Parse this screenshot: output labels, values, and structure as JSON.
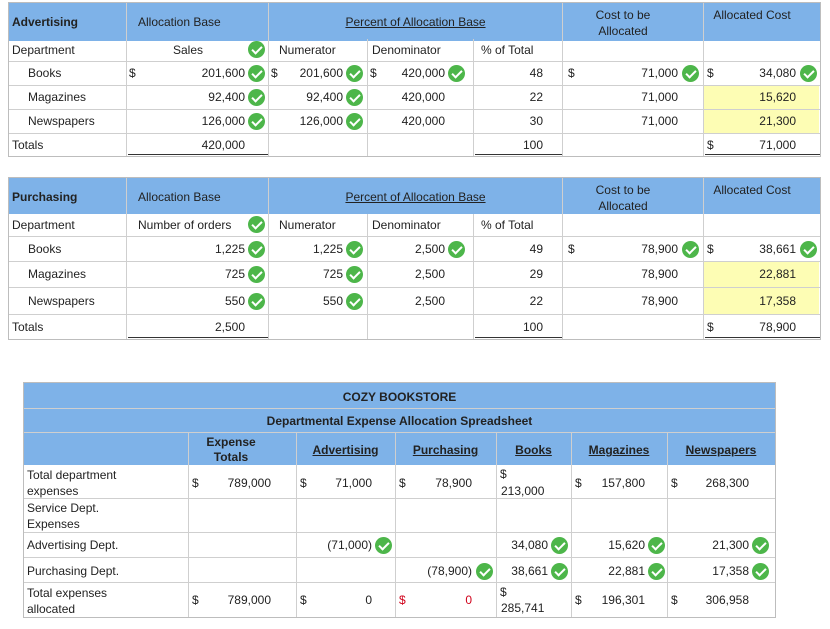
{
  "advertising": {
    "title": "Advertising",
    "alloc_base_hdr": "Allocation Base",
    "percent_hdr": "Percent of Allocation Base",
    "cost_hdr": "Cost to be Allocated",
    "allocated_hdr": "Allocated Cost",
    "dept_label": "Department",
    "base_name": "Sales",
    "numerator_label": "Numerator",
    "denominator_label": "Denominator",
    "pct_label": "% of Total",
    "rows": [
      {
        "name": "Books",
        "base": "201,600",
        "num": "201,600",
        "den": "420,000",
        "pct": "48",
        "cost": "71,000",
        "alloc": "34,080"
      },
      {
        "name": "Magazines",
        "base": "92,400",
        "num": "92,400",
        "den": "420,000",
        "pct": "22",
        "cost": "71,000",
        "alloc": "15,620"
      },
      {
        "name": "Newspapers",
        "base": "126,000",
        "num": "126,000",
        "den": "420,000",
        "pct": "30",
        "cost": "71,000",
        "alloc": "21,300"
      }
    ],
    "totals": {
      "label": "Totals",
      "base": "420,000",
      "pct": "100",
      "alloc": "71,000"
    }
  },
  "purchasing": {
    "title": "Purchasing",
    "alloc_base_hdr": "Allocation Base",
    "percent_hdr": "Percent of Allocation Base",
    "cost_hdr": "Cost to be Allocated",
    "allocated_hdr": "Allocated Cost",
    "dept_label": "Department",
    "base_name": "Number of orders",
    "numerator_label": "Numerator",
    "denominator_label": "Denominator",
    "pct_label": "% of Total",
    "rows": [
      {
        "name": "Books",
        "base": "1,225",
        "num": "1,225",
        "den": "2,500",
        "pct": "49",
        "cost": "78,900",
        "alloc": "38,661"
      },
      {
        "name": "Magazines",
        "base": "725",
        "num": "725",
        "den": "2,500",
        "pct": "29",
        "cost": "78,900",
        "alloc": "22,881"
      },
      {
        "name": "Newspapers",
        "base": "550",
        "num": "550",
        "den": "2,500",
        "pct": "22",
        "cost": "78,900",
        "alloc": "17,358"
      }
    ],
    "totals": {
      "label": "Totals",
      "base": "2,500",
      "pct": "100",
      "alloc": "78,900"
    }
  },
  "spreadsheet": {
    "company": "COZY BOOKSTORE",
    "subtitle": "Departmental Expense Allocation Spreadsheet",
    "col_totals": "Expense Totals",
    "col_adv": "Advertising",
    "col_pur": "Purchasing",
    "col_books": "Books",
    "col_mag": "Magazines",
    "col_news": "Newspapers",
    "dollar": "$",
    "rows": {
      "total_dept": {
        "label": "Total department expenses",
        "total": "789,000",
        "adv": "71,000",
        "pur": "78,900",
        "books": "213,000",
        "mag": "157,800",
        "news": "268,300"
      },
      "service": {
        "label": "Service Dept. Expenses"
      },
      "adv_dept": {
        "label": "Advertising Dept.",
        "adv": "(71,000)",
        "books": "34,080",
        "mag": "15,620",
        "news": "21,300"
      },
      "pur_dept": {
        "label": "Purchasing Dept.",
        "pur": "(78,900)",
        "books": "38,661",
        "mag": "22,881",
        "news": "17,358"
      },
      "total_alloc": {
        "label": "Total expenses allocated",
        "total": "789,000",
        "adv": "0",
        "pur": "0",
        "books": "285,741",
        "mag": "196,301",
        "news": "306,958"
      }
    }
  },
  "colors": {
    "header_blue": "#7eb2e8",
    "check_green": "#4db64a",
    "highlight_yellow": "#fdfdb4",
    "error_red": "#d0021b"
  }
}
